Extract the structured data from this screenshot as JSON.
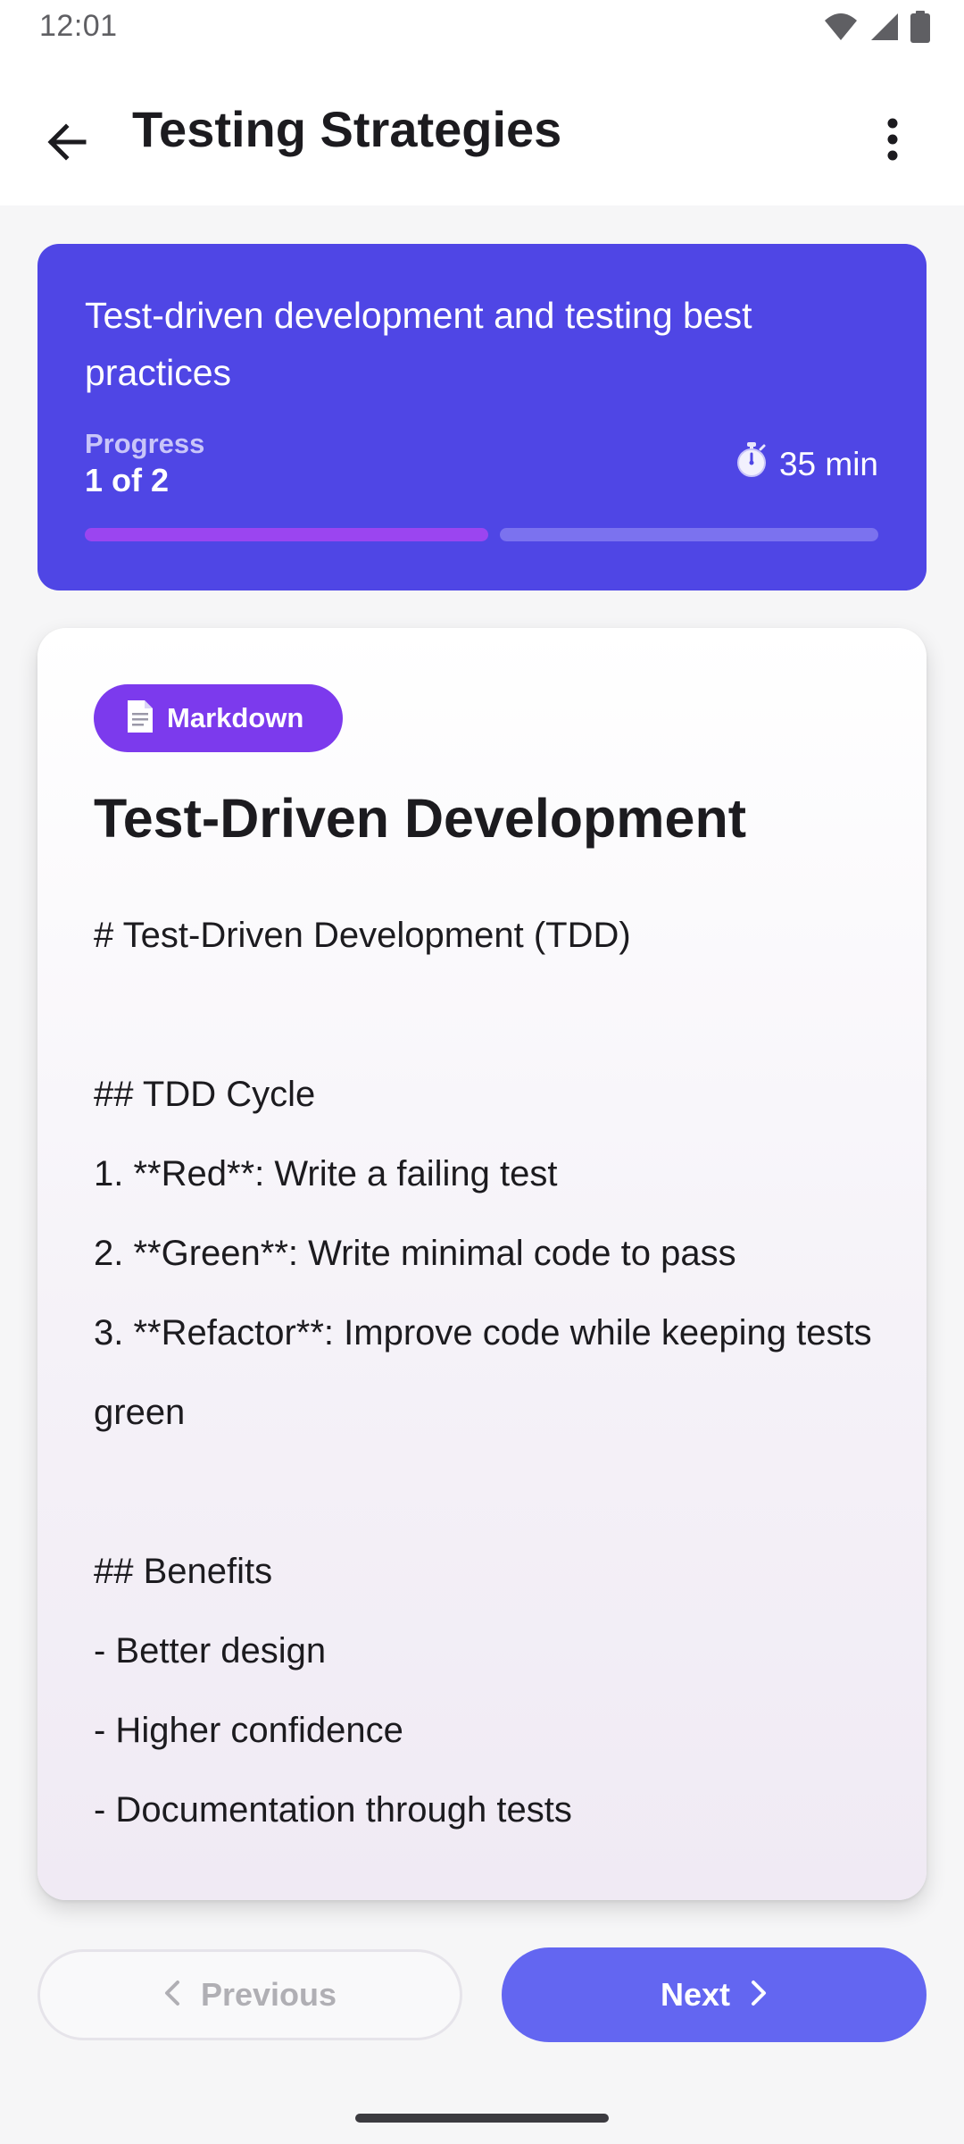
{
  "status_bar": {
    "time": "12:01",
    "icons": [
      "wifi-icon",
      "cell-signal-icon",
      "battery-icon"
    ]
  },
  "app_bar": {
    "title": "Testing Strategies",
    "back_icon": "arrow-back-icon",
    "menu_icon": "more-vert-icon"
  },
  "progress_card": {
    "description": "Test-driven development and testing best practices",
    "progress_label": "Progress",
    "progress_value": "1 of 2",
    "duration_icon": "stopwatch-icon",
    "duration": "35 min",
    "steps_completed": 1,
    "steps_total": 2,
    "color": "#4f46e5"
  },
  "lesson": {
    "type_icon": "document-icon",
    "type_label": "Markdown",
    "title": "Test-Driven Development",
    "body_lines": [
      "# Test-Driven Development (TDD)",
      "",
      "## TDD Cycle",
      "1. **Red**: Write a failing test",
      "2. **Green**: Write minimal code to pass",
      "3. **Refactor**: Improve code while keeping tests green",
      "",
      "## Benefits",
      "- Better design",
      "- Higher confidence",
      "- Documentation through tests"
    ]
  },
  "navigation": {
    "previous_label": "Previous",
    "previous_enabled": false,
    "next_label": "Next",
    "next_enabled": true,
    "accent": "#6366f1"
  }
}
